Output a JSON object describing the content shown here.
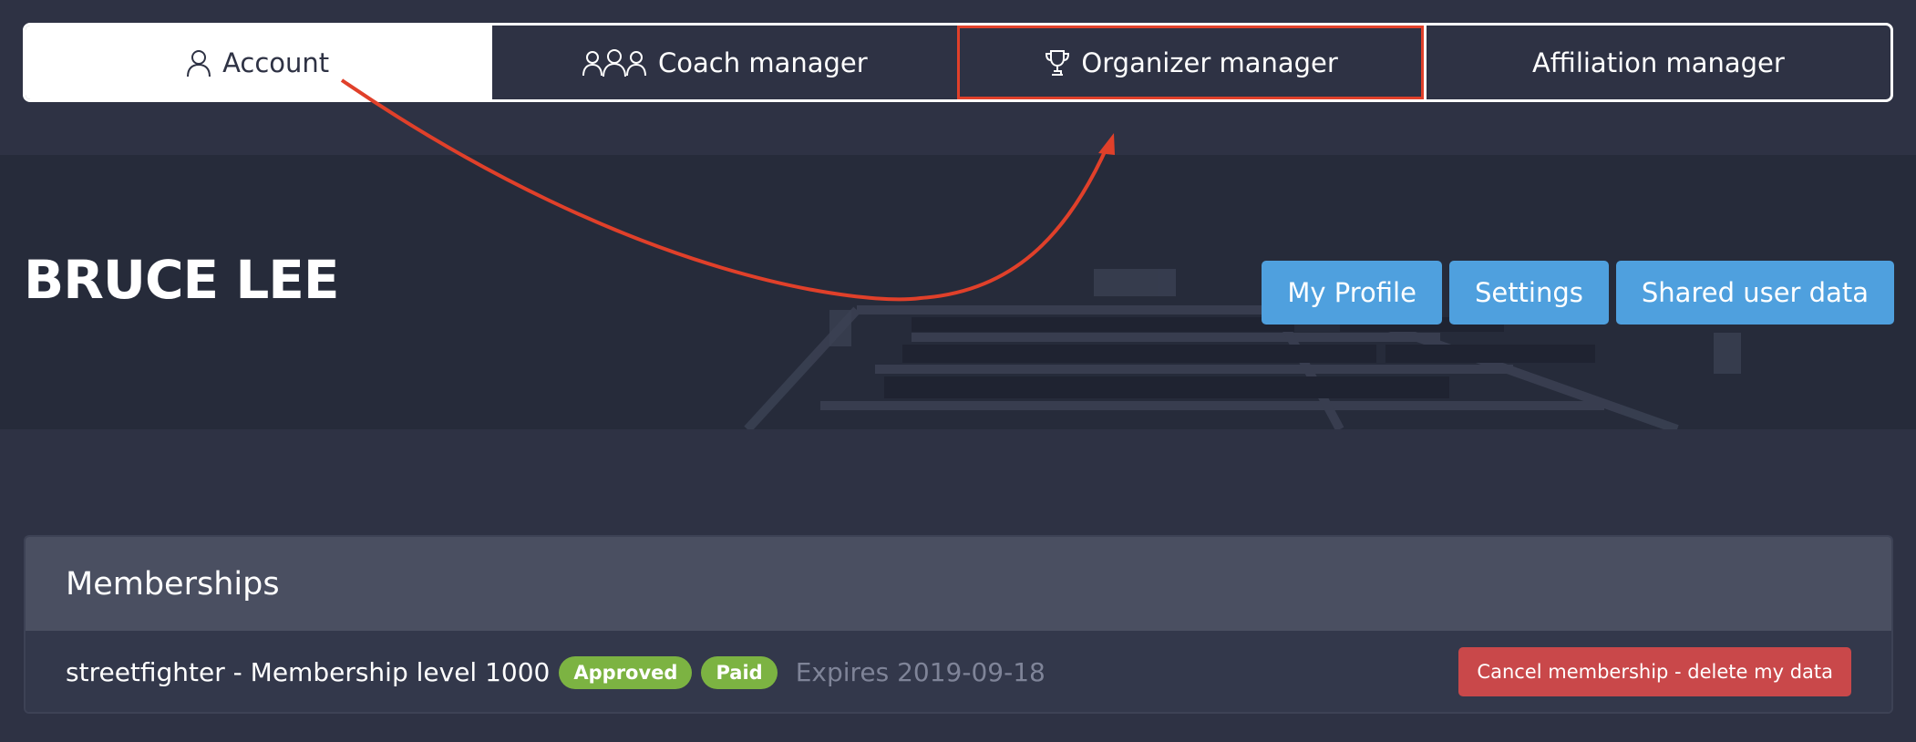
{
  "tabs": [
    {
      "label": "Account",
      "icon": "user-icon",
      "active": true
    },
    {
      "label": "Coach manager",
      "icon": "users-icon",
      "active": false
    },
    {
      "label": "Organizer manager",
      "icon": "trophy-icon",
      "active": false,
      "highlighted": true
    },
    {
      "label": "Affiliation manager",
      "icon": "",
      "active": false
    }
  ],
  "hero": {
    "user_name": "BRUCE LEE",
    "actions": {
      "my_profile": "My Profile",
      "settings": "Settings",
      "shared_user_data": "Shared user data"
    }
  },
  "memberships": {
    "title": "Memberships",
    "items": [
      {
        "name": "streetfighter - Membership level 1000",
        "badges": [
          "Approved",
          "Paid"
        ],
        "expires": "Expires 2019-09-18",
        "cancel_label": "Cancel membership - delete my data"
      }
    ]
  },
  "colors": {
    "background": "#2e3244",
    "primary_button": "#4fa0de",
    "danger_button": "#c9484a",
    "badge_green": "#7cb342",
    "annotation": "#e0402a"
  }
}
